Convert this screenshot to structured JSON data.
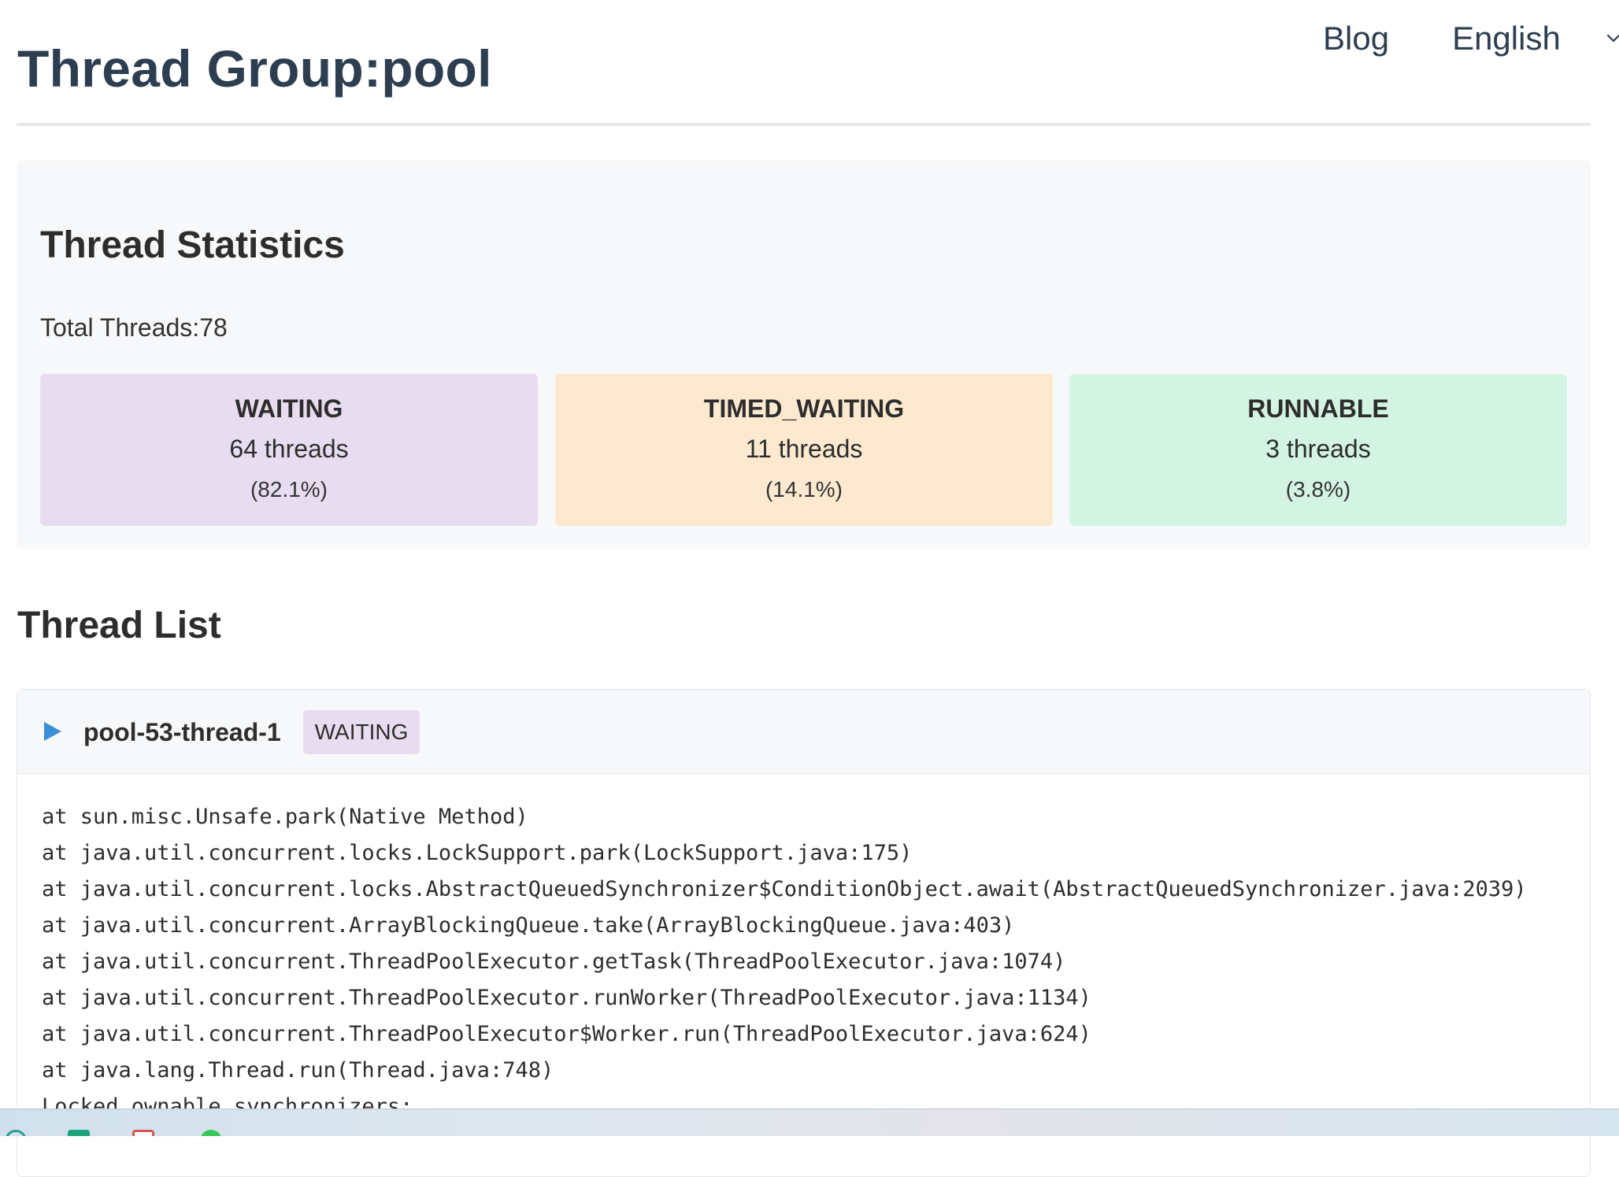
{
  "header": {
    "title": "Thread Group:pool",
    "nav": {
      "blog_label": "Blog",
      "language": "English"
    }
  },
  "statistics": {
    "title": "Thread Statistics",
    "total_threads": "Total Threads:78",
    "cards": [
      {
        "state": "WAITING",
        "count": "64 threads",
        "percent": "(82.1%)",
        "color": "#e8ddf0"
      },
      {
        "state": "TIMED_WAITING",
        "count": "11 threads",
        "percent": "(14.1%)",
        "color": "#fce9cf"
      },
      {
        "state": "RUNNABLE",
        "count": "3 threads",
        "percent": "(3.8%)",
        "color": "#d3f4e2"
      }
    ]
  },
  "thread_list": {
    "title": "Thread List",
    "threads": [
      {
        "name": "pool-53-thread-1",
        "state": "WAITING",
        "stack": [
          "at sun.misc.Unsafe.park(Native Method)",
          "at java.util.concurrent.locks.LockSupport.park(LockSupport.java:175)",
          "at java.util.concurrent.locks.AbstractQueuedSynchronizer$ConditionObject.await(AbstractQueuedSynchronizer.java:2039)",
          "at java.util.concurrent.ArrayBlockingQueue.take(ArrayBlockingQueue.java:403)",
          "at java.util.concurrent.ThreadPoolExecutor.getTask(ThreadPoolExecutor.java:1074)",
          "at java.util.concurrent.ThreadPoolExecutor.runWorker(ThreadPoolExecutor.java:1134)",
          "at java.util.concurrent.ThreadPoolExecutor$Worker.run(ThreadPoolExecutor.java:624)",
          "at java.lang.Thread.run(Thread.java:748)",
          "Locked ownable synchronizers:"
        ]
      }
    ]
  },
  "icons": {
    "expand": "triangle-right-icon",
    "language_dropdown": "chevron-down-icon"
  },
  "colors": {
    "title": "#2c3e50",
    "accent": "#3a8fd9",
    "waiting_badge": "#e8ddf0"
  }
}
